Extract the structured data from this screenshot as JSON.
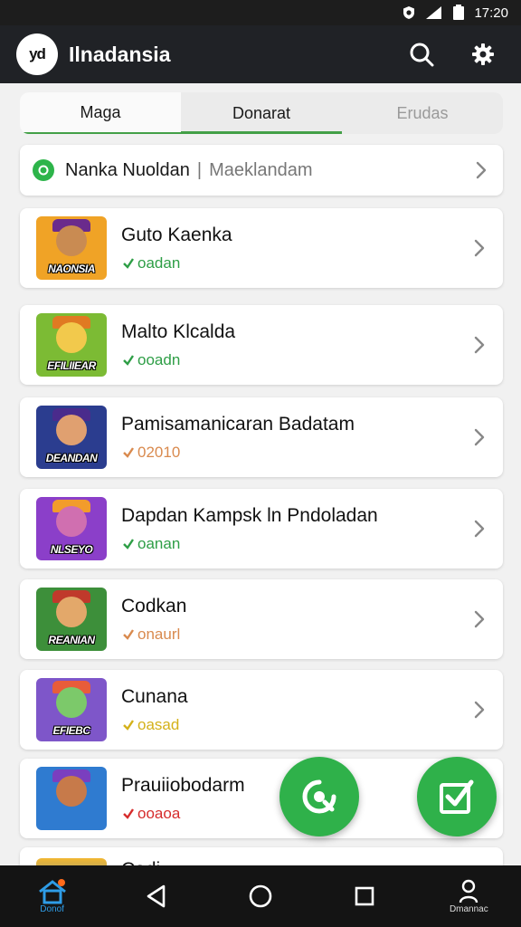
{
  "status": {
    "time": "17:20"
  },
  "app": {
    "logo_text": "yd",
    "title": "Ilnadansia"
  },
  "tabs": [
    {
      "label": "Maga"
    },
    {
      "label": "Donarat"
    },
    {
      "label": "Erudas"
    }
  ],
  "featured": {
    "title": "Nanka Nuoldan",
    "separator": "|",
    "subtitle": "Maeklandam"
  },
  "items": [
    {
      "title": "Guto Kaenka",
      "status": "oadan",
      "status_color": "#2e9e46",
      "thumb_caption": "NAONSIA",
      "thumb_bg": "#f0a326",
      "thumb_face": "#c98b52",
      "thumb_hat": "#6a2b8c"
    },
    {
      "title": "Malto Klcalda",
      "status": "ooadn",
      "status_color": "#2e9e46",
      "thumb_caption": "EFILIIEAR",
      "thumb_bg": "#7cbb34",
      "thumb_face": "#f2c94c",
      "thumb_hat": "#e07a22"
    },
    {
      "title": "Pamisamanicaran Badatam",
      "status": "02010",
      "status_color": "#d98a4e",
      "thumb_caption": "DEANDAN",
      "thumb_bg": "#2b3d8f",
      "thumb_face": "#e0a070",
      "thumb_hat": "#4a2b8c"
    },
    {
      "title": "Dapdan Kampsk ln Pndoladan",
      "status": "oanan",
      "status_color": "#2e9e46",
      "thumb_caption": "NLSEYO",
      "thumb_bg": "#8b3fc9",
      "thumb_face": "#d06fb0",
      "thumb_hat": "#f29c2b"
    },
    {
      "title": "Codkan",
      "status": "onaurl",
      "status_color": "#d98a4e",
      "thumb_caption": "REANIAN",
      "thumb_bg": "#3d8f3a",
      "thumb_face": "#e3a86a",
      "thumb_hat": "#c0392b"
    },
    {
      "title": "Cunana",
      "status": "oasad",
      "status_color": "#d4b11a",
      "thumb_caption": "EFIEBC",
      "thumb_bg": "#7e56c9",
      "thumb_face": "#7cc96a",
      "thumb_hat": "#e85c3a"
    },
    {
      "title": "Prauiiobodarm",
      "status": "ooaoa",
      "status_color": "#d62c2c",
      "thumb_caption": "",
      "thumb_bg": "#2f7bd0",
      "thumb_face": "#c77a4a",
      "thumb_hat": "#7a3fbf"
    }
  ],
  "partial_item": {
    "title": "Cadi"
  },
  "nav": {
    "home_label": "Donof",
    "profile_label": "Dmannac"
  },
  "colors": {
    "accent": "#43a047",
    "fab": "#2fb14a",
    "appbar": "#202226"
  },
  "icons": {
    "app_actions": [
      "search-icon",
      "settings-icon"
    ],
    "fabs": [
      "call-icon",
      "edit-check-icon"
    ]
  }
}
